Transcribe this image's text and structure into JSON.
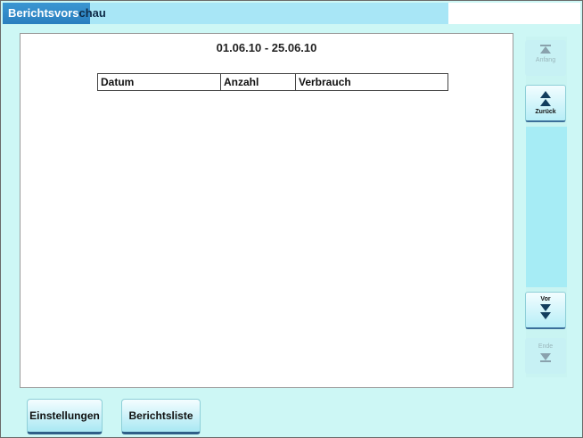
{
  "window": {
    "title_prefix": "Berichtsvors",
    "title_suffix": "chau"
  },
  "report": {
    "date_range": "01.06.10 - 25.06.10",
    "columns": [
      "Datum",
      "Anzahl",
      "Verbrauch"
    ]
  },
  "scroll": {
    "top_label": "Anfang",
    "back_label": "Zurück",
    "forward_label": "Vor",
    "end_label": "Ende"
  },
  "buttons": {
    "settings_label": "Einstellungen",
    "report_list_label": "Berichtsliste"
  },
  "colors": {
    "title_active": "#2a7fbf",
    "title_light": "#a8e6f6",
    "background": "#cdf7f5",
    "scroll_fill": "#a6ecf5",
    "button_border": "#2e5f88"
  }
}
